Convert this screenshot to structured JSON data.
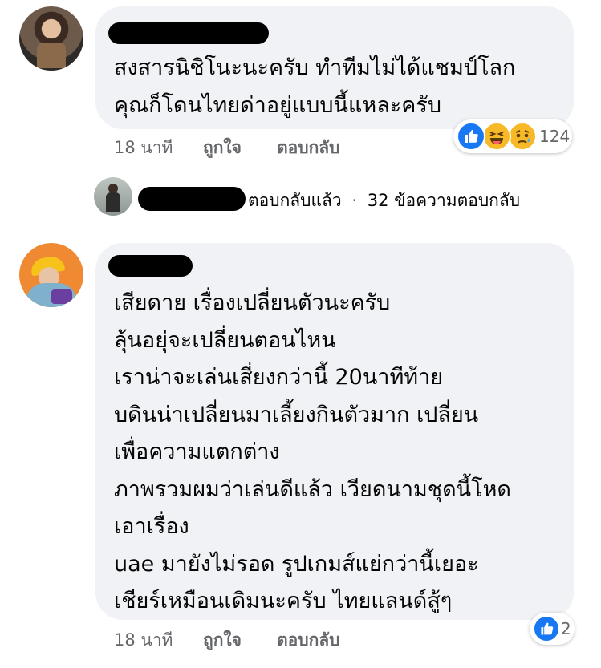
{
  "comments": [
    {
      "lines": [
        "สงสารนิชิโนะนะครับ ทำทีมไม่ได้แชมป์โลก",
        "คุณก็โดนไทยด่าอยู่แบบนี้แหละครับ"
      ],
      "time": "18 นาที",
      "like_label": "ถูกใจ",
      "reply_label": "ตอบกลับ",
      "reactions": [
        "like-icon",
        "haha-icon",
        "sad-icon"
      ],
      "reaction_count": "124"
    },
    {
      "lines": [
        "เสียดาย เรื่องเปลี่ยนตัวนะครับ",
        "ลุ้นอยุ่จะเปลี่ยนตอนไหน",
        "เราน่าจะเล่นเสี่ยงกว่านี้ 20นาทีท้าย",
        "บดินน่าเปลี่ยนมาเลี้ยงกินตัวมาก เปลี่ยน",
        "เพื่อความแตกต่าง",
        "ภาพรวมผมว่าเล่นดีแล้ว เวียดนามชุดนี้โหด",
        "เอาเรื่อง",
        "uae มายังไม่รอด รูปเกมส์แย่กว่านี้เยอะ",
        "เชียร์เหมือนเดิมนะครับ ไทยแลนด์สู้ๆ"
      ],
      "time": "18 นาที",
      "like_label": "ถูกใจ",
      "reply_label": "ตอบกลับ",
      "reactions": [
        "like-icon"
      ],
      "reaction_count": "2"
    }
  ],
  "reply_summary": {
    "replied_label": "ตอบกลับแล้ว",
    "separator": "·",
    "count_label": "32 ข้อความตอบกลับ"
  },
  "colors": {
    "bubble": "#f0f2f5",
    "meta_text": "#65676b",
    "like_blue": "#1877f2",
    "haha_yellow": "#f7b928"
  }
}
